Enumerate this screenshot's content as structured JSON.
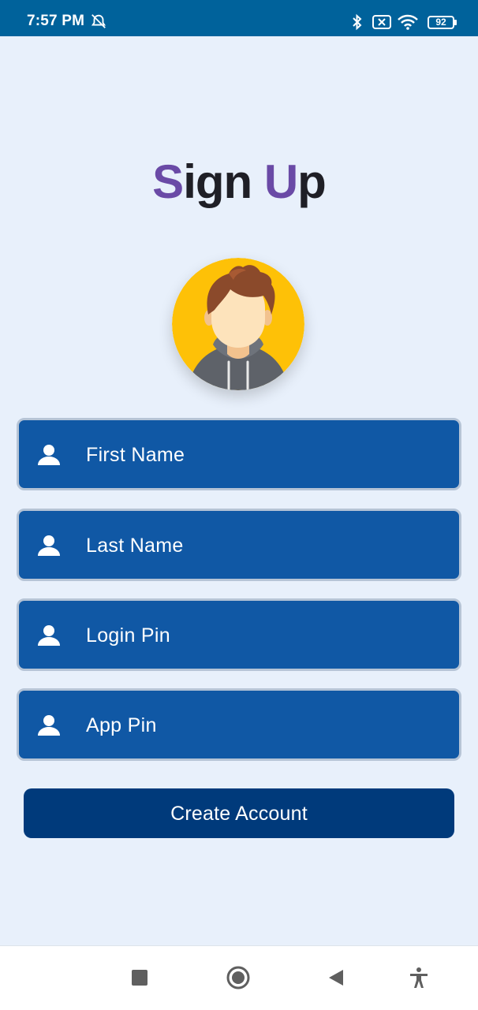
{
  "status_bar": {
    "time": "7:57 PM",
    "battery_level": "92",
    "icons": [
      "alarm-off-icon",
      "bluetooth-icon",
      "sim-off-icon",
      "wifi-icon",
      "battery-icon"
    ]
  },
  "title": {
    "first_letter": "S",
    "rest_1": "ign ",
    "second_letter": "U",
    "rest_2": "p"
  },
  "avatar": {
    "icon": "user-avatar-illustration"
  },
  "form": {
    "fields": [
      {
        "placeholder": "First Name",
        "icon": "person-icon"
      },
      {
        "placeholder": "Last Name",
        "icon": "person-icon"
      },
      {
        "placeholder": "Login Pin",
        "icon": "person-icon"
      },
      {
        "placeholder": "App Pin",
        "icon": "person-icon"
      }
    ],
    "submit_label": "Create Account"
  },
  "nav_bar": {
    "icons": [
      "recent-apps-icon",
      "home-icon",
      "back-icon",
      "accessibility-icon"
    ]
  },
  "colors": {
    "background": "#e8f0fb",
    "status_bar": "#00629b",
    "field": "#1058a5",
    "button": "#003a7b",
    "title_accent": "#6a4aa6"
  }
}
